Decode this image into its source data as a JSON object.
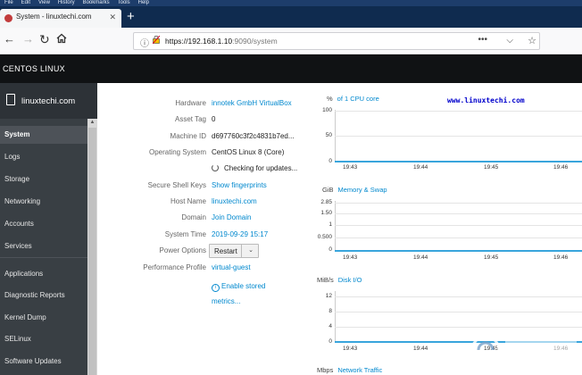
{
  "menubar": [
    "File",
    "Edit",
    "View",
    "History",
    "Bookmarks",
    "Tools",
    "Help"
  ],
  "browser": {
    "tab_title": "System - linuxtechi.com",
    "url_host": "https://192.168.1.10",
    "url_rest": ":9090/system"
  },
  "cockpit": {
    "brand": "CENTOS LINUX",
    "hostname": "linuxtechi.com"
  },
  "sidebar": {
    "items": [
      {
        "label": "System",
        "active": true
      },
      {
        "label": "Logs"
      },
      {
        "label": "Storage"
      },
      {
        "label": "Networking"
      },
      {
        "label": "Accounts"
      },
      {
        "label": "Services"
      },
      {
        "label": "Applications"
      },
      {
        "label": "Diagnostic Reports"
      },
      {
        "label": "Kernel Dump"
      },
      {
        "label": "SELinux"
      },
      {
        "label": "Software Updates"
      }
    ]
  },
  "system_info": {
    "hardware_label": "Hardware",
    "hardware_value": "innotek GmbH VirtualBox",
    "asset_label": "Asset Tag",
    "asset_value": "0",
    "machine_label": "Machine ID",
    "machine_value": "d697760c3f2c4831b7ed...",
    "os_label": "Operating System",
    "os_value": "CentOS Linux 8 (Core)",
    "updates_value": "Checking for updates...",
    "ssh_label": "Secure Shell Keys",
    "ssh_value": "Show fingerprints",
    "host_label": "Host Name",
    "host_value": "linuxtechi.com",
    "domain_label": "Domain",
    "domain_value": "Join Domain",
    "time_label": "System Time",
    "time_value": "2019-09-29 15:17",
    "power_label": "Power Options",
    "power_value": "Restart",
    "profile_label": "Performance Profile",
    "profile_value": "virtual-guest",
    "enable_line1": "Enable stored",
    "enable_line2": "metrics..."
  },
  "watermark": "www.linuxtechi.com",
  "charts": {
    "cpu": {
      "unit": "%",
      "title": "of 1 CPU core",
      "yticks": [
        "100",
        "50",
        "0"
      ]
    },
    "memory": {
      "unit": "GiB",
      "title": "Memory & Swap",
      "yticks": [
        "2.85",
        "1.50",
        "1",
        "0.500",
        "0"
      ]
    },
    "disk": {
      "unit": "MiB/s",
      "title": "Disk I/O",
      "yticks": [
        "12",
        "8",
        "4",
        "0"
      ]
    },
    "network": {
      "unit": "Mbps",
      "title": "Network Traffic"
    },
    "xticks": [
      "19:43",
      "19:44",
      "19:45",
      "19:46"
    ]
  },
  "chart_data": [
    {
      "type": "line",
      "title": "of 1 CPU core",
      "ylabel": "%",
      "x": [
        "19:43",
        "19:44",
        "19:45",
        "19:46"
      ],
      "series": [
        {
          "values": [
            0,
            0,
            0,
            0
          ]
        }
      ],
      "ylim": [
        0,
        100
      ]
    },
    {
      "type": "line",
      "title": "Memory & Swap",
      "ylabel": "GiB",
      "x": [
        "19:43",
        "19:44",
        "19:45",
        "19:46"
      ],
      "series": [
        {
          "values": [
            0,
            0,
            0,
            0
          ]
        }
      ],
      "ylim": [
        0,
        2.85
      ]
    },
    {
      "type": "line",
      "title": "Disk I/O",
      "ylabel": "MiB/s",
      "x": [
        "19:43",
        "19:44",
        "19:45",
        "19:46"
      ],
      "series": [
        {
          "values": [
            0,
            0,
            0,
            0
          ]
        }
      ],
      "ylim": [
        0,
        12
      ]
    }
  ]
}
